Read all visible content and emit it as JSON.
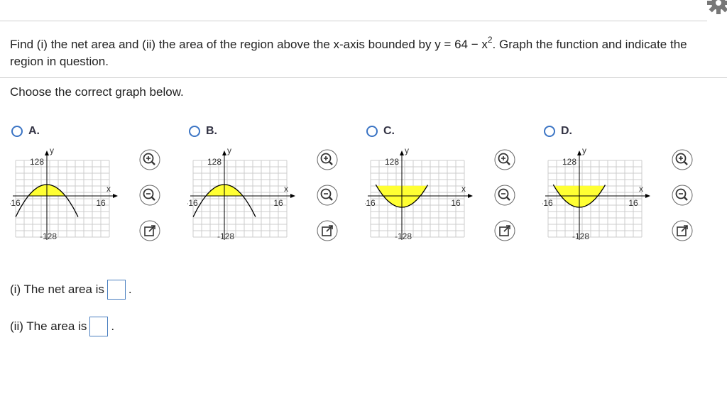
{
  "question": {
    "part1": "Find (i) the net area and (ii) the area of the region above the x-axis bounded by y = 64 − x",
    "superscript": "2",
    "part2": ". Graph the function and indicate the region in question."
  },
  "instruction": "Choose the correct graph below.",
  "options": [
    {
      "letter": "A.",
      "shading": "cap-left",
      "labels": {
        "y": "y",
        "x": "x",
        "y_top": "128",
        "y_bottom": "-128",
        "x_left": "-16",
        "x_right": "16"
      }
    },
    {
      "letter": "B.",
      "shading": "cap",
      "labels": {
        "y": "y",
        "x": "x",
        "y_top": "128",
        "y_bottom": "-128",
        "x_left": "-16",
        "x_right": "16"
      }
    },
    {
      "letter": "C.",
      "shading": "above-upward",
      "labels": {
        "y": "y",
        "x": "x",
        "y_top": "128",
        "y_bottom": "-128",
        "x_left": "-16",
        "x_right": "16"
      }
    },
    {
      "letter": "D.",
      "shading": "above-upward",
      "labels": {
        "y": "y",
        "x": "x",
        "y_top": "128",
        "y_bottom": "-128",
        "x_left": "-16",
        "x_right": "16"
      }
    }
  ],
  "answers": {
    "net_area_label": "(i) The net area is",
    "area_label": "(ii) The area is",
    "suffix": "."
  },
  "colors": {
    "radio": "#3b74c4",
    "shade": "#ffff33",
    "grid": "#cccccc",
    "tool_border": "#555555"
  },
  "icons": [
    "gear-icon",
    "zoom-in-icon",
    "zoom-out-icon",
    "open-new-window-icon"
  ]
}
